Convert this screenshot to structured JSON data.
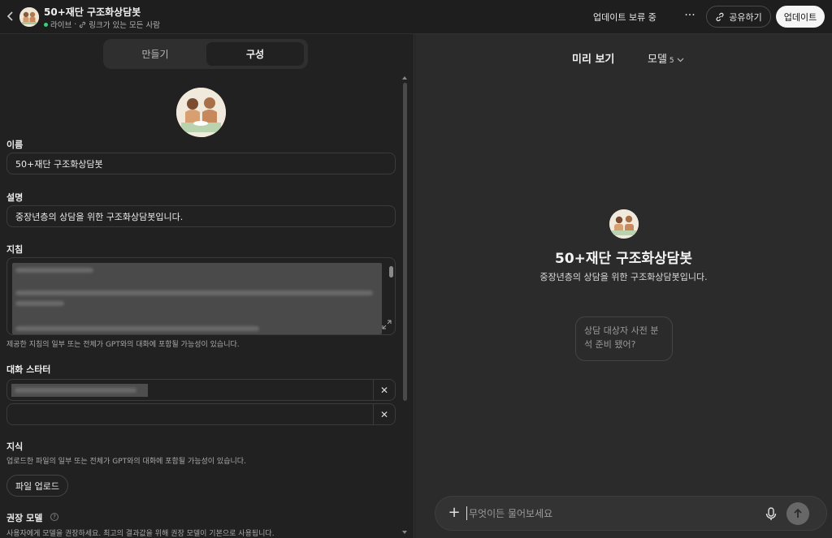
{
  "header": {
    "back_icon": "chevron-left-icon",
    "title": "50+재단 구조화상담봇",
    "live_label": "라이브",
    "visibility_label": "링크가 있는 모든 사람",
    "status": "업데이트 보류 중",
    "more_icon": "ellipsis-icon",
    "share_label": "공유하기",
    "update_label": "업데이트",
    "colors": {
      "live_dot": "#3ccf7a"
    }
  },
  "editor": {
    "tabs": [
      {
        "label": "만들기",
        "active": false
      },
      {
        "label": "구성",
        "active": true
      }
    ],
    "name": {
      "label": "이름",
      "value": "50+재단 구조화상담봇"
    },
    "description": {
      "label": "설명",
      "value": "중장년층의 상담을 위한 구조화상담봇입니다."
    },
    "instructions": {
      "label": "지침",
      "help": "제공한 지침의 일부 또는 전체가 GPT와의 대화에 포함될 가능성이 있습니다."
    },
    "starters": {
      "label": "대화 스타터",
      "clear_icon": "close-icon"
    },
    "knowledge": {
      "label": "지식",
      "help": "업로드한 파일의 일부 또는 전체가 GPT와의 대화에 포함될 가능성이 있습니다.",
      "upload_label": "파일 업로드"
    },
    "recommended_model": {
      "label": "권장 모델",
      "help": "사용자에게 모델을 권장하세요. 최고의 결과값을 위해 권장 모델이 기본으로 사용됩니다."
    }
  },
  "preview": {
    "title": "미리 보기",
    "model_label": "모델",
    "model_version": "5",
    "gpt_name": "50+재단 구조화상담봇",
    "gpt_description": "중장년층의 상담을 위한 구조화상담봇입니다.",
    "starter_card": "상담 대상자 사전 분석 준비 됐어?",
    "composer_placeholder": "무엇이든 물어보세요"
  }
}
